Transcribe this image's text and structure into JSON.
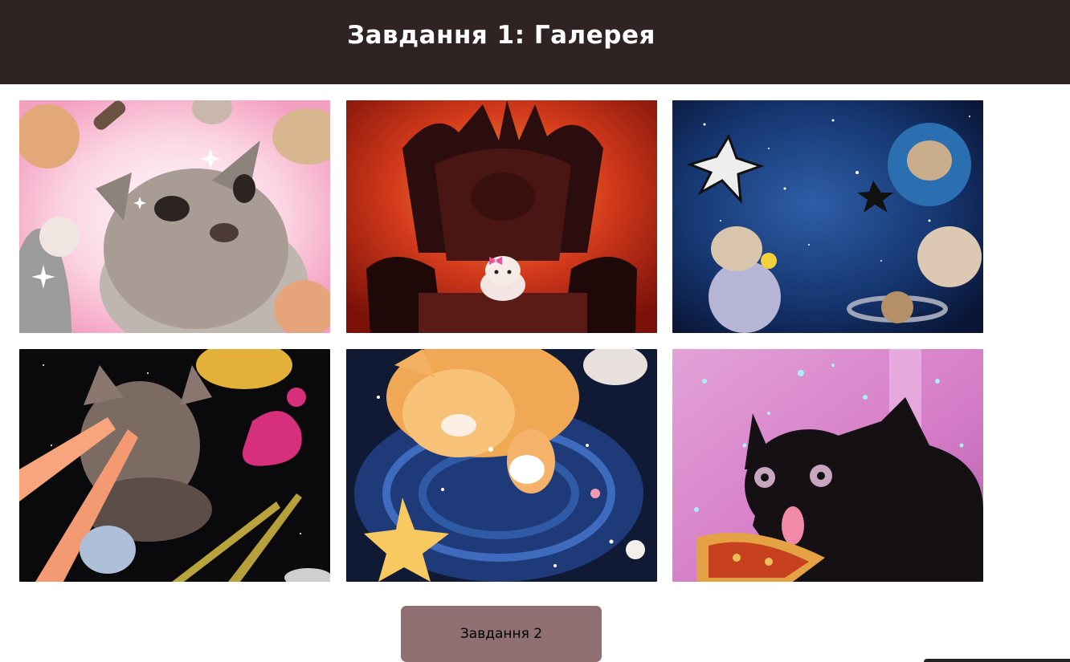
{
  "header": {
    "title": "Завдання 1: Галерея"
  },
  "gallery": {
    "images": [
      {
        "subject": "kittens-pink-sparkles",
        "accent": "#f4b8cf"
      },
      {
        "subject": "kitten-on-dark-throne",
        "accent": "#c8321e"
      },
      {
        "subject": "cats-in-space-planets",
        "accent": "#1d3c7a"
      },
      {
        "subject": "laser-eyes-space-cat",
        "accent": "#0d0d0d"
      },
      {
        "subject": "orange-kitten-star-water",
        "accent": "#e9a64c"
      },
      {
        "subject": "black-cat-pizza-pink",
        "accent": "#d97fc6"
      }
    ]
  },
  "actions": {
    "next_label": "Завдання 2"
  },
  "colors": {
    "header_bg": "#302323",
    "button_bg": "#8f6f72",
    "page_bg": "#ffffff"
  }
}
